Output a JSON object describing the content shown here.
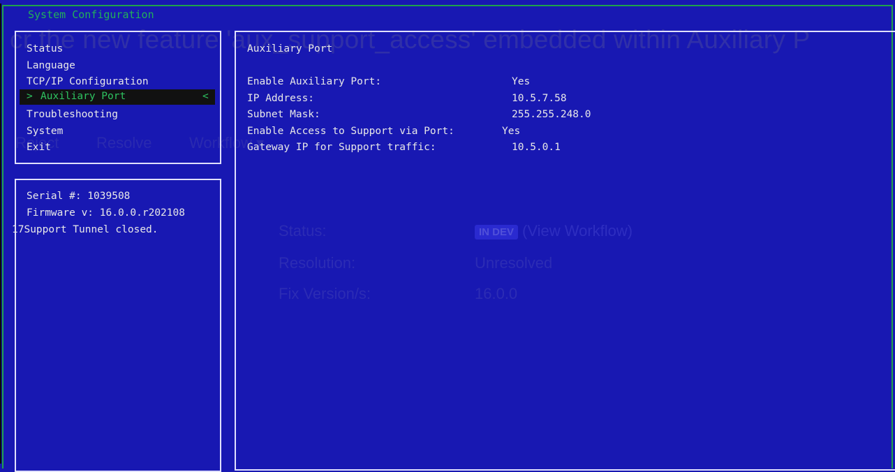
{
  "ghost_page": {
    "title_fragment": "cr the new feature 'aux_support_access' embedded within Auxiliary P",
    "buttons": [
      "Reject",
      "Resolve",
      "Workflow ▾"
    ],
    "fields": [
      {
        "label": "Status:",
        "badge": "IN DEV",
        "value": "(View Workflow)"
      },
      {
        "label": "Resolution:",
        "value": "Unresolved"
      },
      {
        "label": "Fix Version/s:",
        "value": "16.0.0"
      }
    ]
  },
  "window": {
    "title": "System Configuration"
  },
  "menu": {
    "items": [
      "Status",
      "Language",
      "TCP/IP Configuration",
      "Auxiliary Port",
      "Troubleshooting",
      "System",
      "Exit"
    ],
    "selected_index": 3,
    "selected_marker_left": ">",
    "selected_marker_right": "<"
  },
  "info": {
    "serial": "Serial #: 1039508",
    "firmware": "Firmware v: 16.0.0.r202108",
    "tunnel": "17Support Tunnel closed."
  },
  "detail": {
    "heading": "Auxiliary Port",
    "rows": [
      {
        "label": "Enable Auxiliary Port:",
        "value": "Yes"
      },
      {
        "label": "IP Address:",
        "value": "10.5.7.58"
      },
      {
        "label": "Subnet Mask:",
        "value": "255.255.248.0"
      },
      {
        "label": "Enable Access to Support via Port:",
        "value": "Yes"
      },
      {
        "label": "Gateway IP for Support traffic:",
        "value": "10.5.0.1"
      }
    ]
  },
  "colors": {
    "background": "#1818b2",
    "frame": "#1fa24a",
    "selected_fg": "#2ec460",
    "selected_bg": "#111111"
  }
}
